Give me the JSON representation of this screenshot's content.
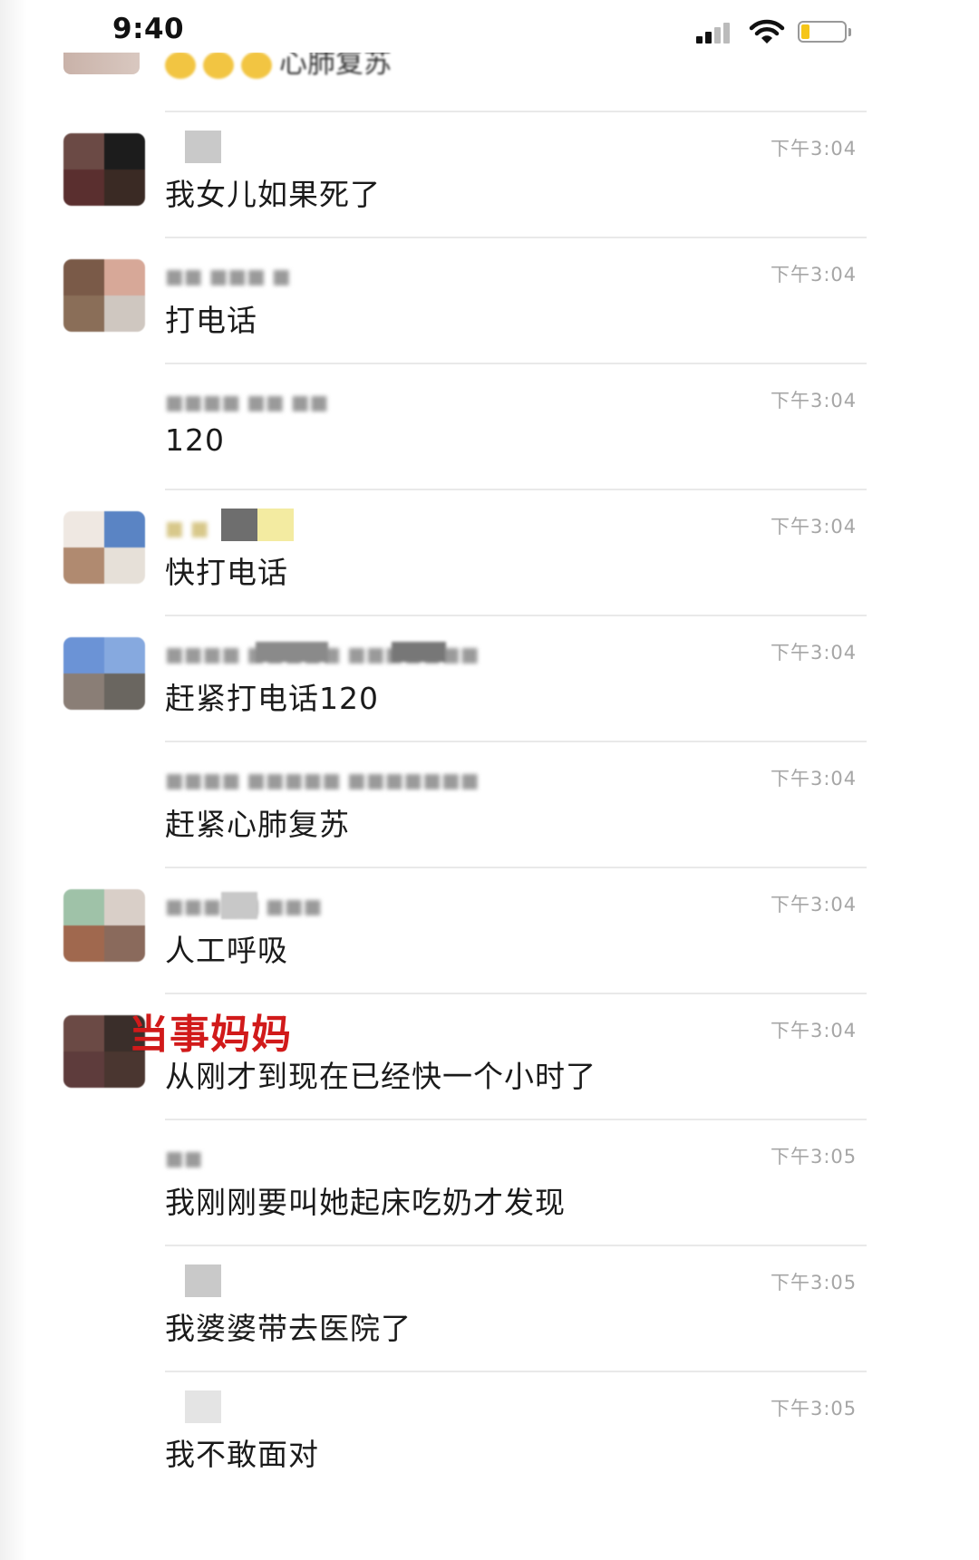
{
  "status_bar": {
    "time": "9:40",
    "icons": [
      "cellular-signal-icon",
      "wifi-icon",
      "battery-icon"
    ],
    "battery_level": 0.2,
    "battery_color": "#f5c518"
  },
  "partial_message": {
    "text": "心肺复苏",
    "emoji_count": 3
  },
  "messages": [
    {
      "time": "下午3:04",
      "text": "我女儿如果死了",
      "has_avatar": true
    },
    {
      "time": "下午3:04",
      "text": "打电话",
      "has_avatar": true
    },
    {
      "time": "下午3:04",
      "text": "120",
      "has_avatar": false
    },
    {
      "time": "下午3:04",
      "text": "快打电话",
      "has_avatar": true
    },
    {
      "time": "下午3:04",
      "text": "赶紧打电话120",
      "has_avatar": true
    },
    {
      "time": "下午3:04",
      "text": "赶紧心肺复苏",
      "has_avatar": false
    },
    {
      "time": "下午3:04",
      "text": "人工呼吸",
      "has_avatar": true
    },
    {
      "time": "下午3:04",
      "text": "从刚才到现在已经快一个小时了",
      "has_avatar": true,
      "annotation": "当事妈妈"
    },
    {
      "time": "下午3:05",
      "text": "我刚刚要叫她起床吃奶才发现",
      "has_avatar": false
    },
    {
      "time": "下午3:05",
      "text": "我婆婆带去医院了",
      "has_avatar": false
    },
    {
      "time": "下午3:05",
      "text": "我不敢面对",
      "has_avatar": false
    }
  ],
  "colors": {
    "annotation": "#d11a1a",
    "timestamp": "#a6a6a6",
    "message_text": "#1a1a1a",
    "divider": "#e9e9e9"
  }
}
